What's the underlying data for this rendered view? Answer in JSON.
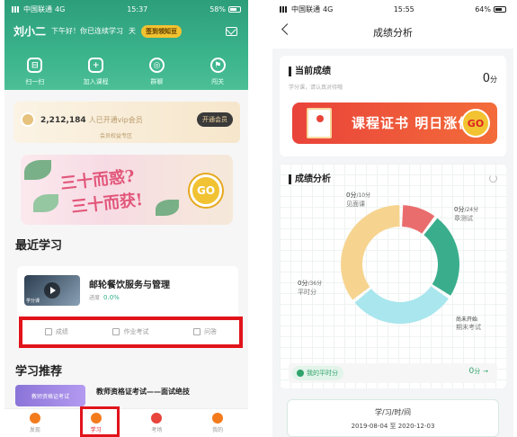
{
  "left": {
    "status": {
      "carrier": "中国联通",
      "network": "4G",
      "time": "15:37",
      "battery": "58%"
    },
    "user": {
      "name": "刘小二",
      "greeting": "下午好！你已连续学习",
      "days": "天",
      "sign_btn": "签到领知豆"
    },
    "quick": [
      {
        "label": "扫一扫",
        "icon": "scan-icon"
      },
      {
        "label": "加入课程",
        "icon": "add-course-icon"
      },
      {
        "label": "群聊",
        "icon": "chat-icon"
      },
      {
        "label": "闯关",
        "icon": "challenge-icon"
      }
    ],
    "vip": {
      "count": "2,212,184",
      "text": "人已开通vip会员",
      "sub": "会员权益专区",
      "btn": "开通会员"
    },
    "banner": {
      "line1": "三十而惑?",
      "line2": "三十而获!",
      "go": "GO"
    },
    "recent_title": "最近学习",
    "course": {
      "title": "邮轮餐饮服务与管理",
      "progress_label": "进度",
      "progress": "0.0%",
      "thumb_tag": "学分课"
    },
    "actions": [
      {
        "label": "成绩",
        "icon": "grade-icon"
      },
      {
        "label": "作业考试",
        "icon": "exam-icon"
      },
      {
        "label": "问答",
        "icon": "qa-icon"
      }
    ],
    "rec_title": "学习推荐",
    "rec": {
      "badge": "教师资格证考试",
      "title": "教师资格证考试——面试绝技"
    },
    "tabs": [
      {
        "label": "发现",
        "active": false
      },
      {
        "label": "学习",
        "active": true
      },
      {
        "label": "考场",
        "active": false
      },
      {
        "label": "我的",
        "active": false
      }
    ]
  },
  "right": {
    "status": {
      "carrier": "中国联通",
      "network": "4G",
      "time": "15:55",
      "battery": "64%"
    },
    "title": "成绩分析",
    "current": {
      "heading": "当前成绩",
      "sub": "学分课，请认真对待哦",
      "score": "0",
      "unit": "分"
    },
    "cert_banner": {
      "text": "课程证书 明日涨价",
      "go": "GO"
    },
    "analysis": {
      "heading": "成绩分析",
      "segments": [
        {
          "score": "0分",
          "total": "/10分",
          "name": "见面课",
          "color": "#ea6d6d",
          "weight": 10
        },
        {
          "score": "0分",
          "total": "/24分",
          "name": "章测试",
          "color": "#3aae8c",
          "weight": 24
        },
        {
          "score": "",
          "total": "",
          "name": "",
          "color": "#a9e6ee",
          "weight": 30
        },
        {
          "score": "0分",
          "total": "/36分",
          "name": "平时分",
          "color": "#f6d48f",
          "weight": 36
        }
      ],
      "final_status": "尚未开始",
      "final_name": "期末考试"
    },
    "my_score": {
      "label": "我的平时分",
      "value": "0",
      "unit": "分",
      "arrow": "→"
    },
    "study_time": {
      "label": "学/习/时/间",
      "range": "2019-08-04 至 2020-12-03"
    }
  }
}
